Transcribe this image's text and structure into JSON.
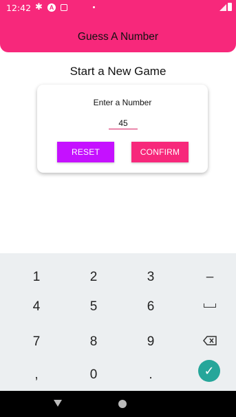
{
  "status_bar": {
    "time": "12:42",
    "icons": [
      "gear-icon",
      "android-icon",
      "box-icon",
      "dot-icon",
      "signal-icon",
      "battery-icon"
    ]
  },
  "header": {
    "title": "Guess A Number",
    "background": "#f7287b"
  },
  "main": {
    "subtitle": "Start a New Game",
    "card": {
      "label": "Enter a Number",
      "input_value": "45",
      "reset_label": "RESET",
      "confirm_label": "CONFIRM",
      "reset_color": "#c511ff",
      "confirm_color": "#f7287b"
    }
  },
  "keyboard": {
    "rows": [
      [
        "1",
        "2",
        "3",
        "–"
      ],
      [
        "4",
        "5",
        "6",
        "space"
      ],
      [
        "7",
        "8",
        "9",
        "backspace"
      ],
      [
        ",",
        "0",
        ".",
        "confirm"
      ]
    ],
    "confirm_color": "#26a69a"
  },
  "nav_bar": {
    "icons": [
      "back-icon",
      "home-icon"
    ]
  }
}
